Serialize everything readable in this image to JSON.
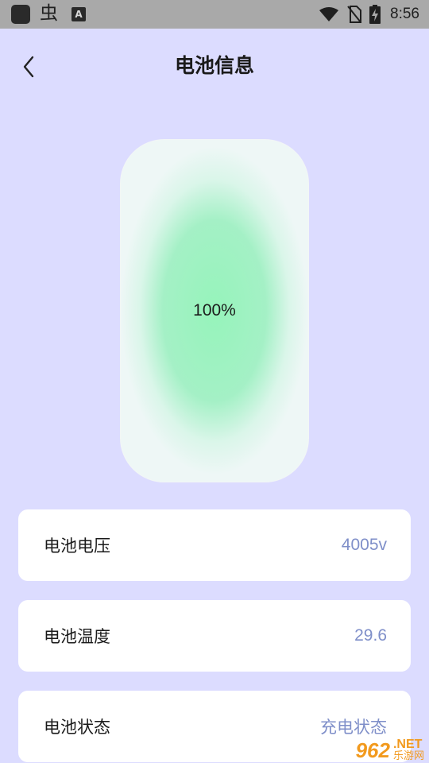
{
  "status_bar": {
    "app_glyph": "虫",
    "a_badge": "A",
    "time": "8:56",
    "icons": [
      "wifi-icon",
      "no-sim-icon",
      "battery-charging-icon"
    ]
  },
  "header": {
    "back_icon": "chevron-left-icon",
    "title": "电池信息"
  },
  "battery_visual": {
    "level_text": "100%",
    "level": 1.0
  },
  "info_cards": [
    {
      "label": "电池电压",
      "value": "4005v"
    },
    {
      "label": "电池温度",
      "value": "29.6"
    },
    {
      "label": "电池状态",
      "value": "充电状态"
    }
  ],
  "watermark": {
    "number": "962",
    "net": ".NET",
    "site": "乐游网"
  },
  "colors": {
    "page_background": "#dcdcff",
    "status_bar": "#a9a9a9",
    "value_text": "#7f8fc9",
    "battery_fill": "#96f4bb",
    "watermark": "#f29a1e"
  }
}
